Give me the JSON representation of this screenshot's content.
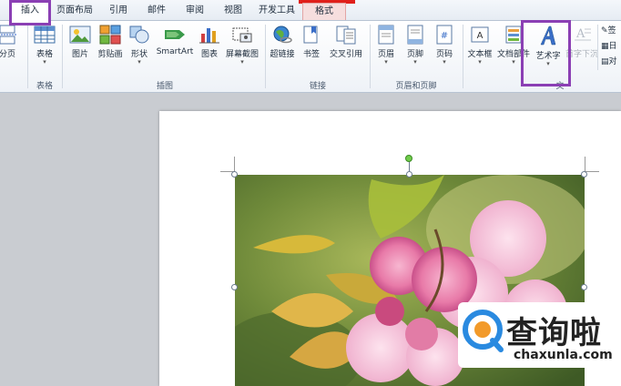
{
  "tabs": [
    {
      "label": "插入",
      "active": true
    },
    {
      "label": "页面布局"
    },
    {
      "label": "引用"
    },
    {
      "label": "邮件"
    },
    {
      "label": "审阅"
    },
    {
      "label": "视图"
    },
    {
      "label": "开发工具"
    },
    {
      "label": "格式",
      "contextual": true
    }
  ],
  "ribbon": {
    "pages": {
      "label": "分页"
    },
    "table": {
      "label": "表格"
    },
    "picture": {
      "label": "图片"
    },
    "clipart": {
      "label": "剪贴画"
    },
    "shapes": {
      "label": "形状"
    },
    "smartart": {
      "label": "SmartArt"
    },
    "chart": {
      "label": "图表"
    },
    "screenshot": {
      "label": "屏幕截图"
    },
    "hyperlink": {
      "label": "超链接"
    },
    "bookmark": {
      "label": "书签"
    },
    "crossref": {
      "label": "交叉引用"
    },
    "header": {
      "label": "页眉"
    },
    "footer": {
      "label": "页脚"
    },
    "pagenum": {
      "label": "页码"
    },
    "textbox": {
      "label": "文本框"
    },
    "docparts": {
      "label": "文档部件"
    },
    "wordart": {
      "label": "艺术字"
    },
    "dropcap": {
      "label": "首字下沉"
    },
    "small_items": [
      "签",
      "日",
      "对"
    ],
    "groups": {
      "tables": "表格",
      "illustrations": "插图",
      "links": "链接",
      "header_footer": "页眉和页脚",
      "text": "文"
    }
  },
  "watermark": {
    "title": "查询啦",
    "url": "chaxunla.com"
  },
  "colors": {
    "highlight": "#8b3fb4",
    "accent_red": "#e0201b"
  }
}
